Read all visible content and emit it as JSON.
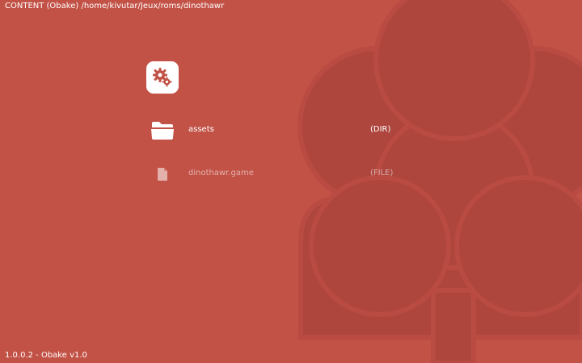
{
  "header": {
    "path_text": "CONTENT (Obake) /home/kivutar/Jeux/roms/dinothawr"
  },
  "settings_button": {
    "icon": "gears-icon"
  },
  "files": [
    {
      "name": "assets",
      "type": "(DIR)",
      "icon": "folder-icon",
      "selected": true
    },
    {
      "name": "dinothawr.game",
      "type": "(FILE)",
      "icon": "file-icon",
      "selected": false
    }
  ],
  "footer": {
    "version_text": "1.0.0.2 - Obake v1.0"
  },
  "colors": {
    "background": "#c25146",
    "logo_overlay": "#ad463f",
    "text": "#ffffff"
  },
  "background_logo": {
    "icon": "obake-logo-icon"
  }
}
